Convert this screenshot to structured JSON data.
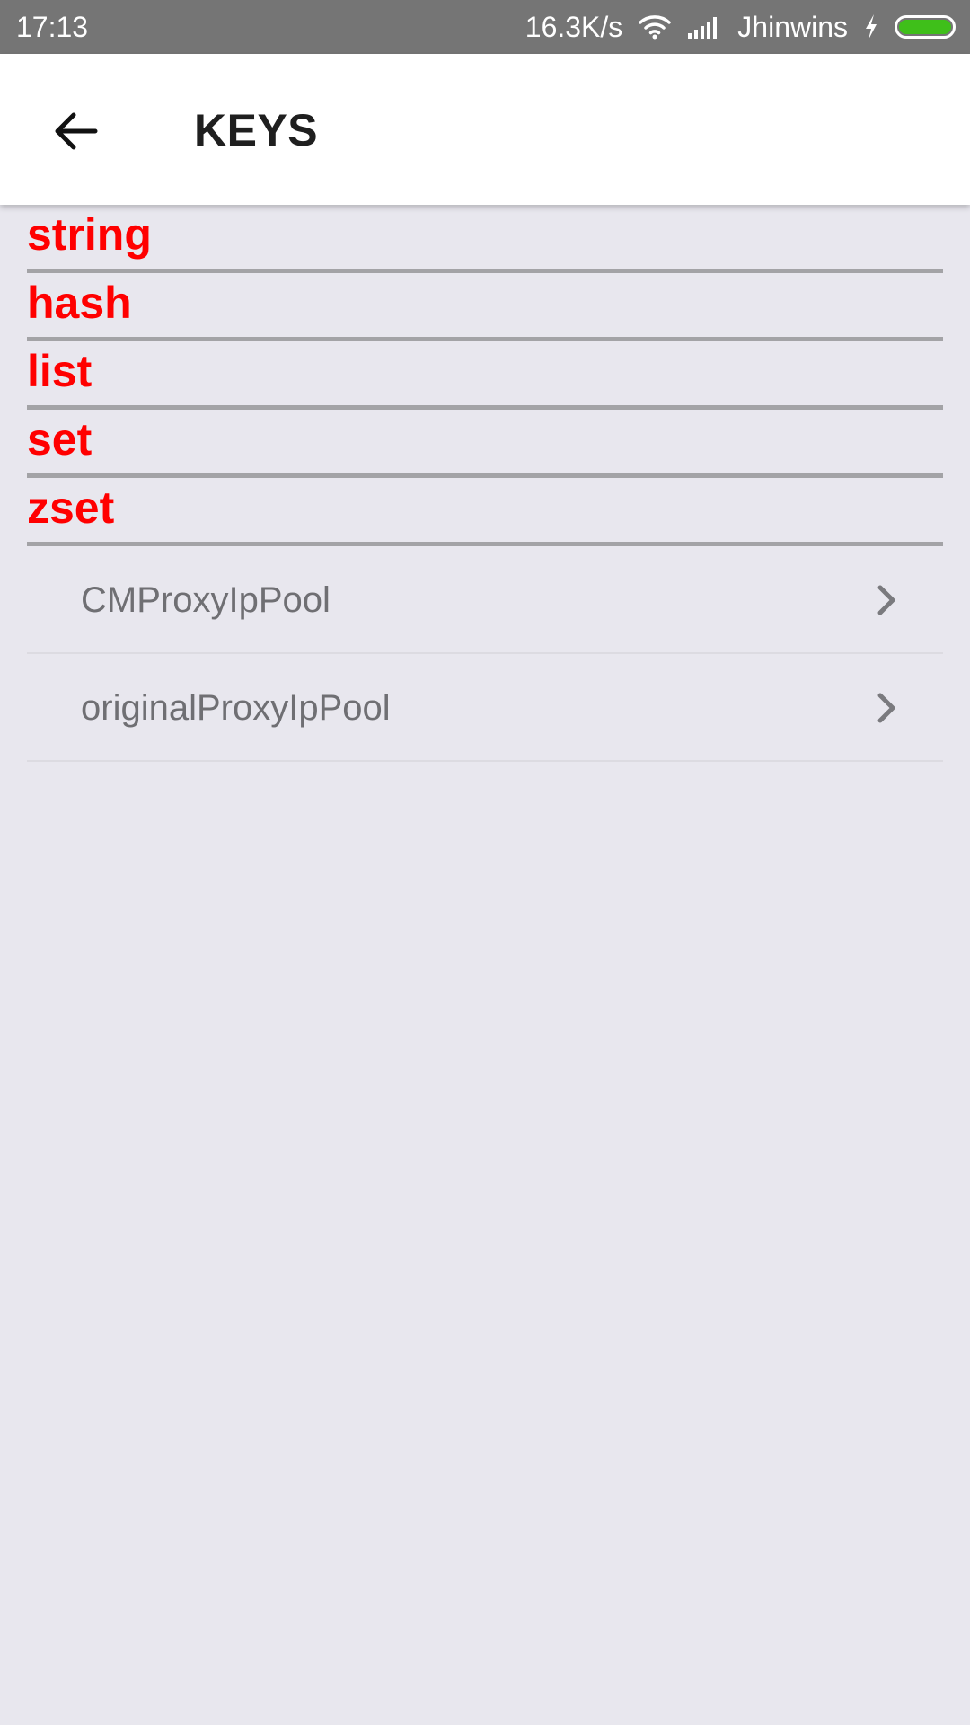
{
  "status_bar": {
    "time": "17:13",
    "net_speed": "16.3K/s",
    "carrier": "Jhinwins",
    "battery_color": "#3fbf1a",
    "icons": [
      "wifi-icon",
      "signal-icon",
      "charging-icon",
      "battery-icon"
    ]
  },
  "app_bar": {
    "title": "KEYS",
    "back_icon": "arrow-left-icon"
  },
  "categories": [
    {
      "label": "string"
    },
    {
      "label": "hash"
    },
    {
      "label": "list"
    },
    {
      "label": "set"
    },
    {
      "label": "zset"
    }
  ],
  "keys": [
    {
      "label": "CMProxyIpPool",
      "icon": "chevron-right-icon"
    },
    {
      "label": "originalProxyIpPool",
      "icon": "chevron-right-icon"
    }
  ],
  "colors": {
    "category_text": "#ff0000",
    "status_bar_bg": "#757575",
    "background": "#e8e7ee"
  }
}
